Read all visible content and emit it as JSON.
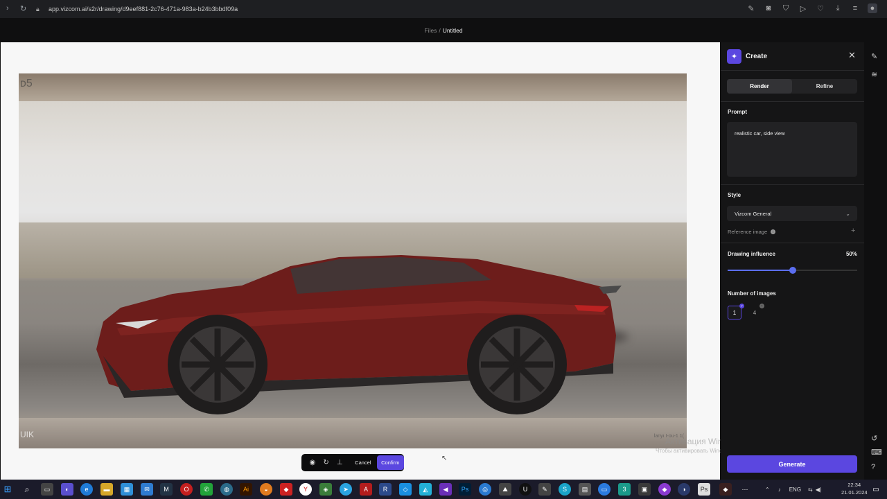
{
  "browser": {
    "url": "app.vizcom.ai/s2r/drawing/d9eef881-2c76-471a-983a-b24b3bbdf09a",
    "icons": [
      "back-icon",
      "reload-icon",
      "lock-icon",
      "edit-icon",
      "camera-icon",
      "shield-icon",
      "play-icon",
      "heart-icon",
      "download-icon",
      "menu-icon",
      "profile-icon"
    ]
  },
  "header": {
    "breadcrumb_files": "Files",
    "breadcrumb_sep": "/",
    "title": "Untitled"
  },
  "canvas": {
    "watermark_top_left": "ᴅ5",
    "watermark_bottom_left": "UIK",
    "watermark_bottom_right": "lanyı I-ou-1 1(",
    "toolbar": {
      "cancel_label": "Cancel",
      "confirm_label": "Confirm"
    }
  },
  "activation": {
    "line1": "Активация Windows",
    "line2": "Чтобы активировать Windows, перейдите в раздел \"Параметры\"."
  },
  "panel": {
    "title": "Create",
    "tabs": [
      {
        "label": "Render",
        "active": true
      },
      {
        "label": "Refine",
        "active": false
      }
    ],
    "prompt_label": "Prompt",
    "prompt_value": "realistic car, side view",
    "style_label": "Style",
    "style_value": "Vizcom General",
    "reference_label": "Reference image",
    "influence_label": "Drawing influence",
    "influence_value": "50%",
    "influence_fraction": 0.5,
    "num_images_label": "Number of images",
    "num_images_options": [
      "1",
      "4"
    ],
    "num_images_selected": "1",
    "generate_label": "Generate",
    "accent_color": "#5b47e0"
  },
  "taskbar": {
    "lang": "ENG",
    "time": "22:34",
    "date": "21.01.2024"
  }
}
